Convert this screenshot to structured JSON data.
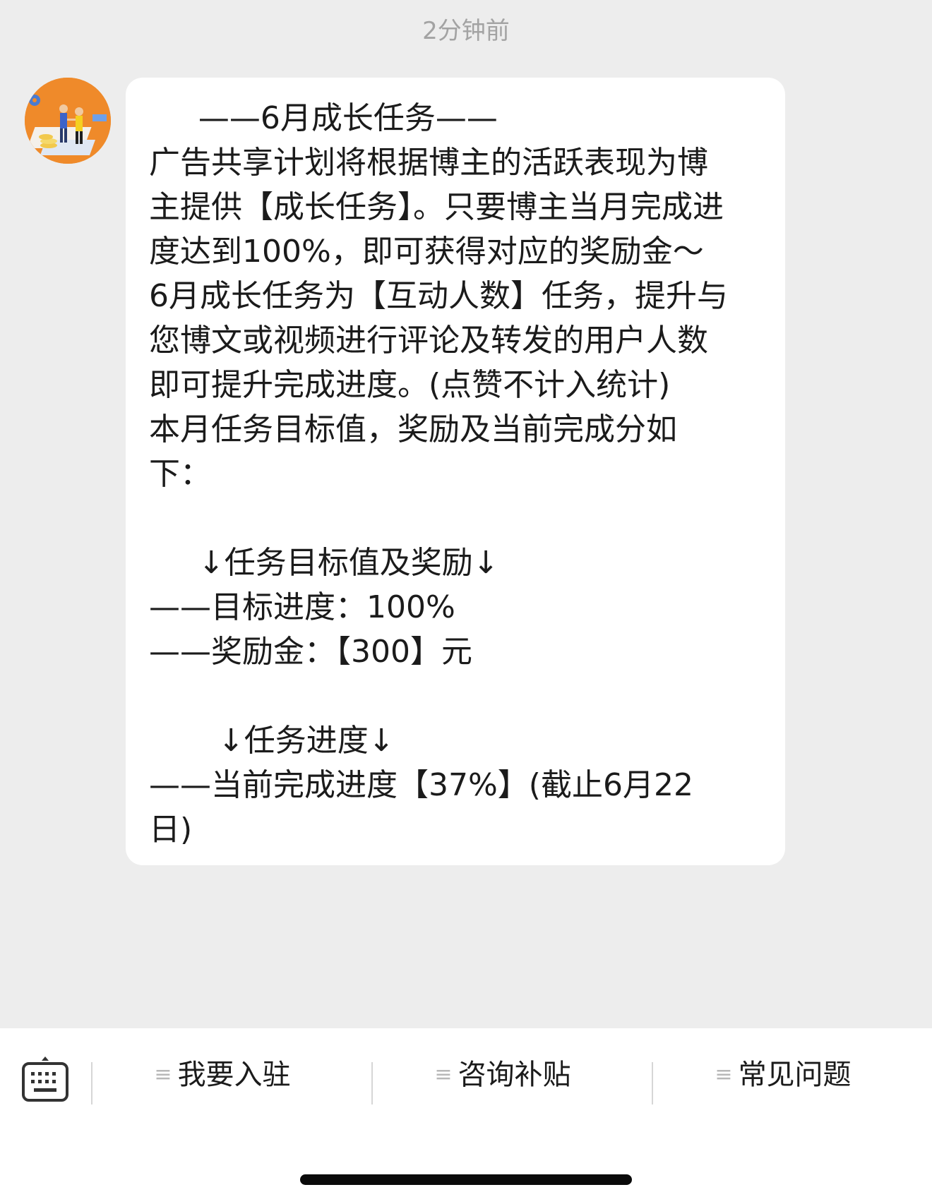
{
  "chat": {
    "timestamp": "2分钟前",
    "message_lines": [
      "     ——6月成长任务——",
      "广告共享计划将根据博主的活跃表现为博",
      "主提供【成长任务】。只要博主当月完成进",
      "度达到100%，即可获得对应的奖励金～",
      "6月成长任务为【互动人数】任务，提升与",
      "您博文或视频进行评论及转发的用户人数",
      "即可提升完成进度。(点赞不计入统计)",
      "本月任务目标值，奖励及当前完成分如",
      "下：",
      "",
      "     ↓任务目标值及奖励↓",
      "——目标进度：100%",
      "——奖励金：【300】元",
      "",
      "       ↓任务进度↓",
      "——当前完成进度【37%】(截止6月22",
      "日)"
    ]
  },
  "bottom_menu": {
    "keyboard_icon": "keyboard-icon",
    "menu_icon": "≡",
    "items": [
      {
        "label": "我要入驻"
      },
      {
        "label": "咨询补贴"
      },
      {
        "label": "常见问题"
      }
    ]
  },
  "colors": {
    "background": "#ededed",
    "bubble": "#ffffff",
    "text": "#1b1b1b",
    "timestamp": "#a3a3a3",
    "avatar_bg": "#ef8a2a"
  }
}
